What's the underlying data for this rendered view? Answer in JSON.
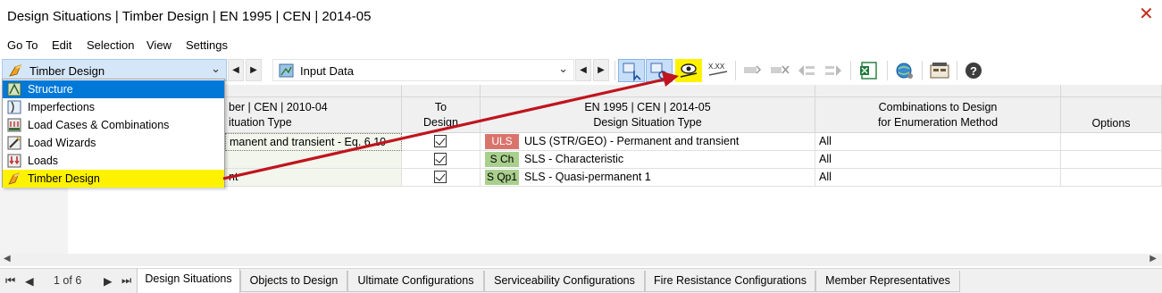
{
  "window": {
    "title": "Design Situations | Timber Design | EN 1995 | CEN | 2014-05"
  },
  "menu": [
    "Go To",
    "Edit",
    "Selection",
    "View",
    "Settings"
  ],
  "toolbar": {
    "module_combo": "Timber Design",
    "table_combo": "Input Data",
    "xxx_label": "X.XX"
  },
  "dropdown": {
    "items": [
      {
        "label": "Structure",
        "icon": "structure-icon",
        "state": "selected"
      },
      {
        "label": "Imperfections",
        "icon": "imperfections-icon",
        "state": ""
      },
      {
        "label": "Load Cases & Combinations",
        "icon": "load-cases-icon",
        "state": ""
      },
      {
        "label": "Load Wizards",
        "icon": "load-wizards-icon",
        "state": ""
      },
      {
        "label": "Loads",
        "icon": "loads-icon",
        "state": ""
      },
      {
        "label": "Timber Design",
        "icon": "timber-design-icon",
        "state": "highlighted"
      }
    ]
  },
  "table": {
    "headers": {
      "col1_line1": "ber | CEN | 2010-04",
      "col1_line2": "ituation Type",
      "col2_line1": "To",
      "col2_line2": "Design",
      "col3_line1": "EN 1995 | CEN | 2014-05",
      "col3_line2": "Design Situation Type",
      "col4_line1": "Combinations to Design",
      "col4_line2": "for Enumeration Method",
      "col5": "Options"
    },
    "rows": [
      {
        "situation": "manent and transient - Eq. 6.10",
        "to_design": true,
        "badge": "ULS",
        "badge_color": "#d9746d",
        "badge_text_color": "#ffffff",
        "type": "ULS (STR/GEO) - Permanent and transient",
        "combinations": "All"
      },
      {
        "situation": "",
        "to_design": true,
        "badge": "S Ch",
        "badge_color": "#a9cf8d",
        "badge_text_color": "#000000",
        "type": "SLS - Characteristic",
        "combinations": "All"
      },
      {
        "situation": "nt",
        "to_design": true,
        "badge": "S Qp1",
        "badge_color": "#a9cf8d",
        "badge_text_color": "#000000",
        "type": "SLS - Quasi-permanent 1",
        "combinations": "All"
      }
    ]
  },
  "pager": {
    "text": "1 of 6"
  },
  "tabs": [
    "Design Situations",
    "Objects to Design",
    "Ultimate Configurations",
    "Serviceability Configurations",
    "Fire Resistance Configurations",
    "Member Representatives"
  ],
  "colors": {
    "accent": "#0078d7",
    "highlight": "#fff200",
    "arrow": "#c0141e"
  }
}
